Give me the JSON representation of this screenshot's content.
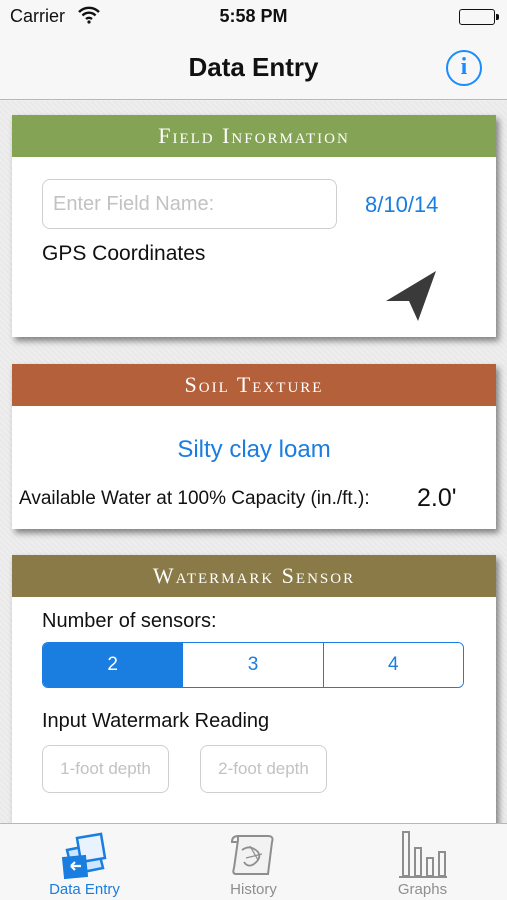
{
  "status_bar": {
    "carrier": "Carrier",
    "time": "5:58 PM"
  },
  "nav": {
    "title": "Data Entry",
    "info_icon": "info-icon",
    "info_glyph": "i"
  },
  "field_information": {
    "header": "Field Information",
    "field_name_placeholder": "Enter Field Name:",
    "date": "8/10/14",
    "gps_label": "GPS Coordinates",
    "location_icon": "location-arrow-icon"
  },
  "soil_texture": {
    "header": "Soil Texture",
    "soil_type": "Silty clay loam",
    "available_water_label": "Available Water at 100% Capacity (in./ft.):",
    "available_water_value": "2.0'"
  },
  "watermark_sensor": {
    "header": "Watermark Sensor",
    "number_of_sensors_label": "Number of sensors:",
    "sensor_options": [
      "2",
      "3",
      "4"
    ],
    "selected_sensor_count": "2",
    "input_reading_label": "Input Watermark Reading",
    "depth_placeholders": [
      "1-foot depth",
      "2-foot depth"
    ]
  },
  "tab_bar": {
    "tabs": [
      {
        "label": "Data Entry",
        "icon": "data-entry-icon",
        "active": true
      },
      {
        "label": "History",
        "icon": "history-icon",
        "active": false
      },
      {
        "label": "Graphs",
        "icon": "graphs-icon",
        "active": false
      }
    ]
  },
  "colors": {
    "accent": "#1a7de0",
    "field_header": "#85a354",
    "soil_header": "#b4603b",
    "watermark_header": "#8a7a48"
  }
}
